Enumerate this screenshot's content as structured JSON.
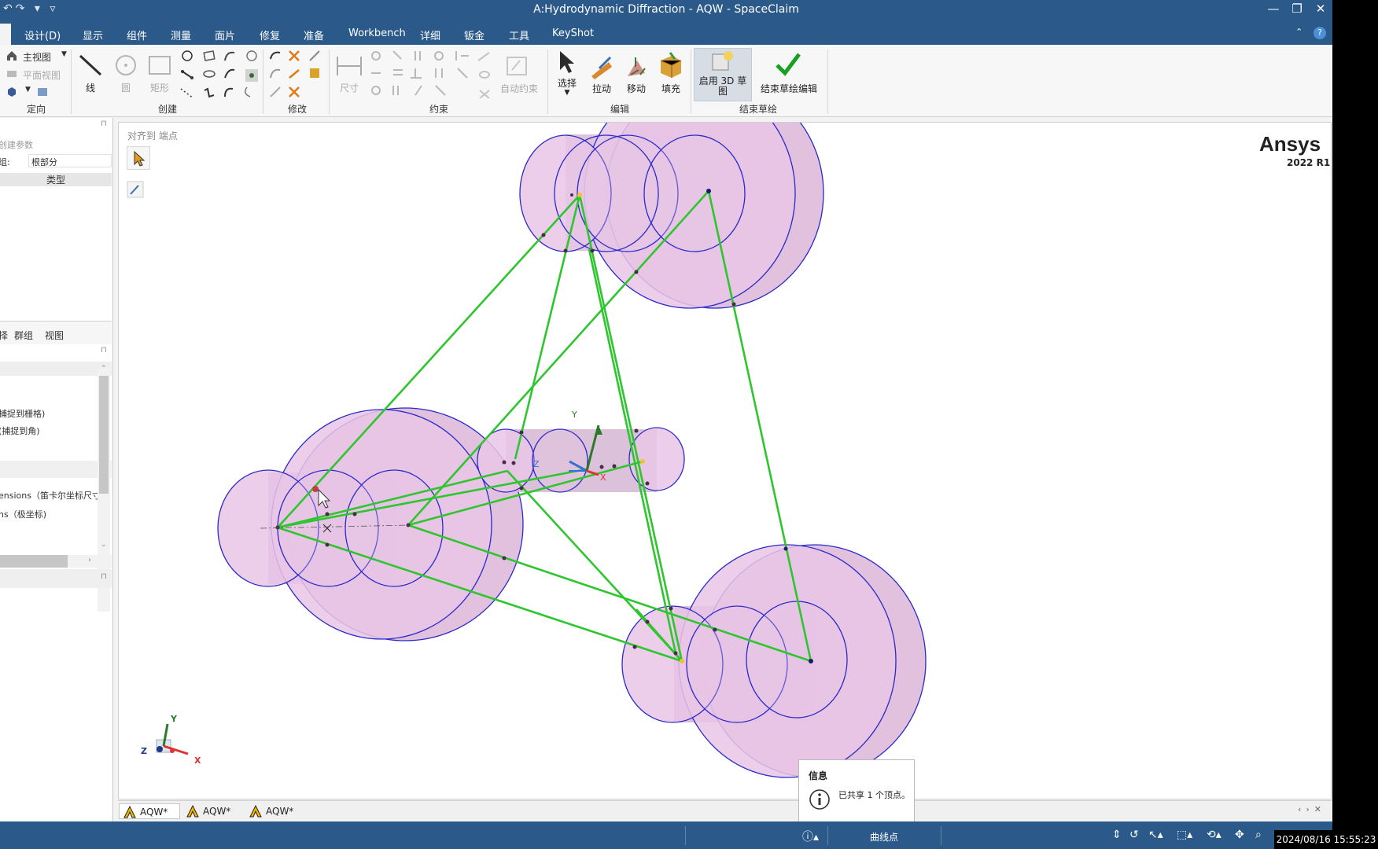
{
  "window": {
    "title": "A:Hydrodynamic Diffraction - AQW - SpaceClaim",
    "min": "—",
    "max": "❐",
    "close": "✕"
  },
  "menu": {
    "tabs": [
      "设计(D)",
      "显示",
      "组件",
      "测量",
      "面片",
      "修复",
      "准备",
      "Workbench",
      "详细",
      "钣金",
      "工具",
      "KeyShot"
    ],
    "help": "?"
  },
  "ribbon": {
    "orient": {
      "home": "主视图",
      "plan": "平面视图",
      "label": "定向"
    },
    "create": {
      "line": "线",
      "circle": "圆",
      "rect": "矩形",
      "label": "创建"
    },
    "modify": {
      "label": "修改"
    },
    "constraint": {
      "dim": "尺寸",
      "auto": "自动约束",
      "label": "约束"
    },
    "edit": {
      "select": "选择",
      "pull": "拉动",
      "move": "移动",
      "fill": "填充",
      "label": "编辑"
    },
    "finish": {
      "enable3d": "启用 3D 草图",
      "finish": "结束草绘编辑",
      "label": "结束草绘"
    }
  },
  "leftpanel": {
    "create_params": "创建参数",
    "group_label": "组:",
    "group_value": "根部分",
    "type_header": "类型",
    "tabs": [
      "择",
      "群组",
      "视图"
    ],
    "options": [
      "捕捉到栅格)",
      "(捕捉到角)"
    ],
    "dims": [
      "ensions（笛卡尔坐标尺寸",
      "ns（极坐标)"
    ]
  },
  "viewport": {
    "hint": "对齐到 端点",
    "brand": "Ansys",
    "version": "2022 R1",
    "axis_y": "Y",
    "axis_z": "Z",
    "axis_x": "X"
  },
  "doctabs": [
    "AQW*",
    "AQW*",
    "AQW*"
  ],
  "info": {
    "title": "信息",
    "message": "已共享 1 个顶点。"
  },
  "status": {
    "mode": "曲线点",
    "timestamp": "2024/08/16 15:55:23"
  },
  "colors": {
    "titlebar": "#2b5a8a",
    "sketch_line": "#2ec52e",
    "body_fill": "#e9c6e6",
    "body_edge": "#2a2ac8"
  }
}
